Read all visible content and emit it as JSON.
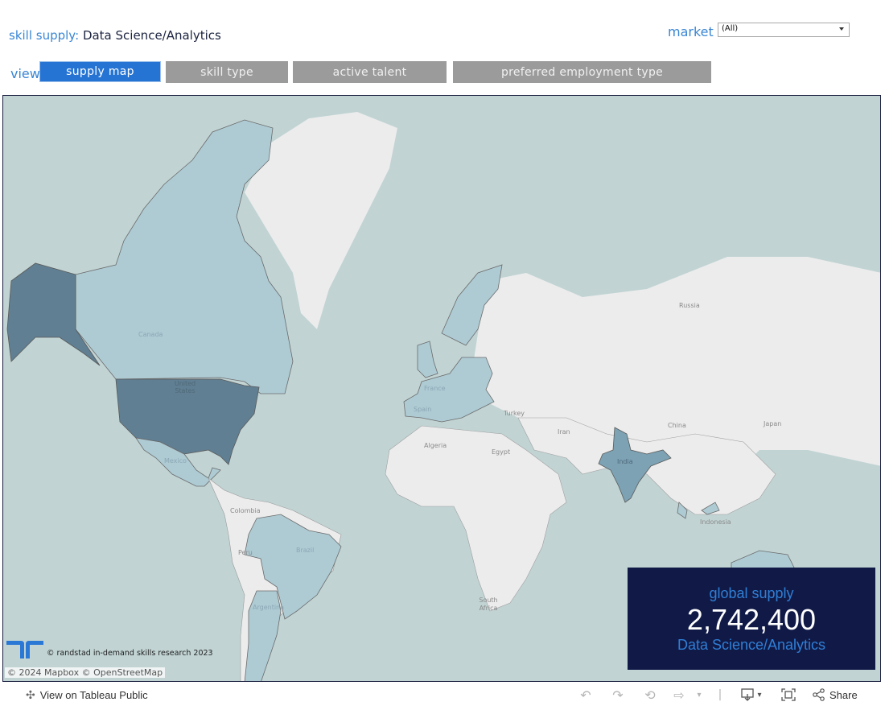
{
  "header": {
    "title_label": "skill supply:",
    "title_value": "Data Science/Analytics",
    "market_label": "market",
    "market_selected": "(All)"
  },
  "view": {
    "label": "view",
    "tabs": [
      {
        "label": "supply map",
        "active": true
      },
      {
        "label": "skill type",
        "active": false
      },
      {
        "label": "active talent",
        "active": false
      },
      {
        "label": "preferred employment type",
        "active": false
      }
    ]
  },
  "map": {
    "labels": {
      "canada": "Canada",
      "united_states": "United States",
      "mexico": "Mexico",
      "colombia": "Colombia",
      "peru": "Peru",
      "brazil": "Brazil",
      "argentina": "Argentina",
      "france": "France",
      "spain": "Spain",
      "turkey": "Turkey",
      "algeria": "Algeria",
      "egypt": "Egypt",
      "iran": "Iran",
      "india": "India",
      "china": "China",
      "japan": "Japan",
      "russia": "Russia",
      "indonesia": "Indonesia",
      "south_africa": "South Africa"
    },
    "colors": {
      "ocean": "#c1d3d3",
      "land": "#ececec",
      "supply_low": "#aecbd4",
      "supply_mid": "#7ca2b4",
      "supply_high": "#607f92",
      "border": "#6b6b6b"
    },
    "copyright": "© randstad in-demand skills research 2023",
    "attribution": "© 2024 Mapbox  © OpenStreetMap"
  },
  "kpi": {
    "title": "global supply",
    "value": "2,742,400",
    "subtitle": "Data Science/Analytics"
  },
  "footer": {
    "view_on_tableau": "View on Tableau Public",
    "share": "Share",
    "icons": [
      "undo-icon",
      "redo-icon",
      "revert-icon",
      "refresh-icon",
      "download-icon",
      "fullscreen-icon",
      "share-icon"
    ]
  },
  "colors": {
    "accent": "#2574d4",
    "label_blue": "#3a86d4",
    "tab_inactive": "#9b9b9b",
    "kpi_bg": "#111a47"
  }
}
